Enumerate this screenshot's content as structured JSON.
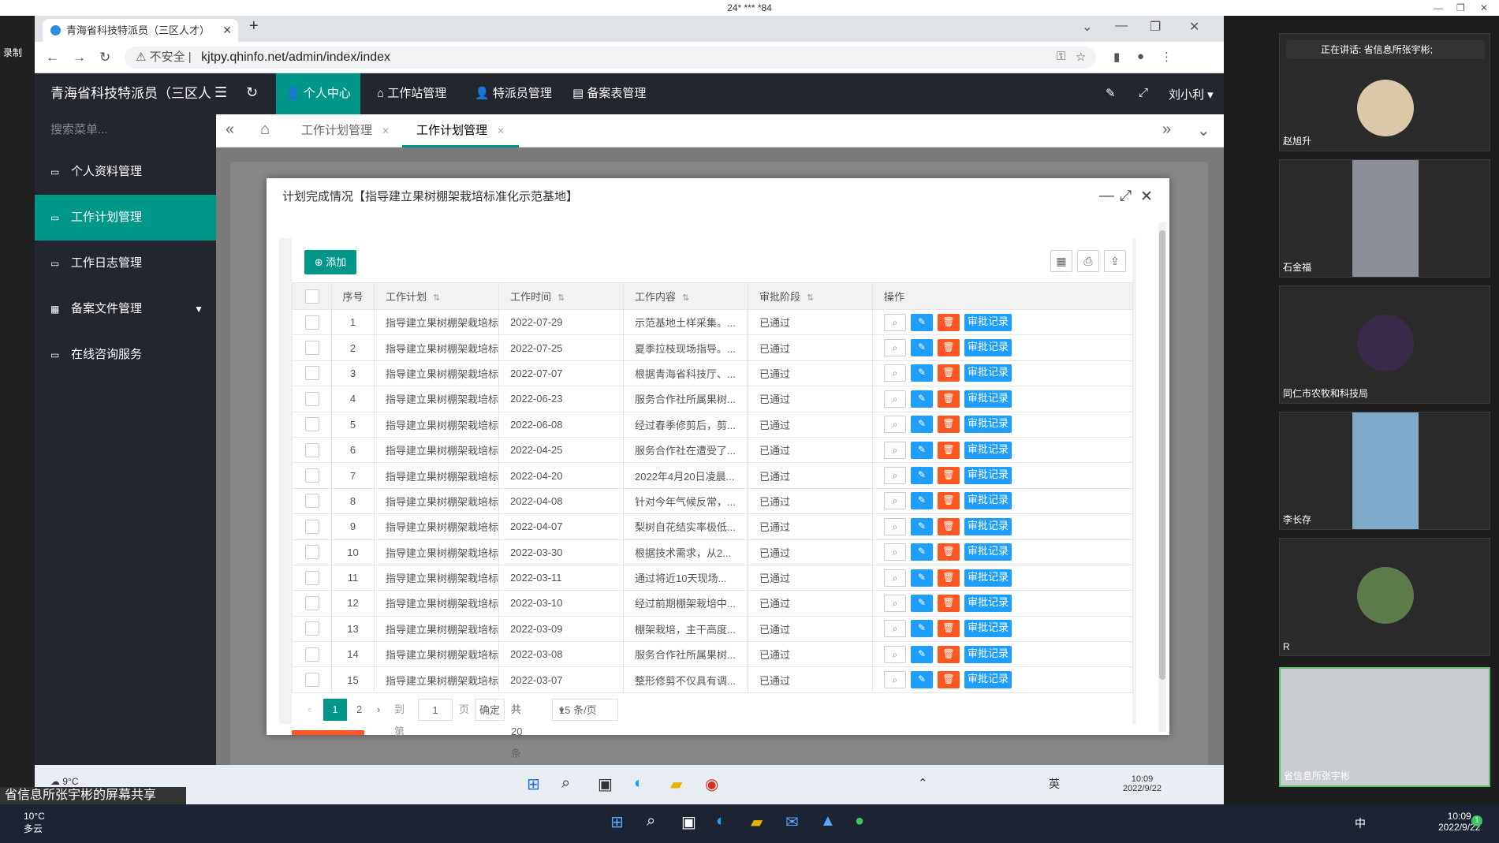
{
  "top_caption": "24* *** *84",
  "browser": {
    "tab_title": "青海省科技特派员（三区人才）",
    "url": "kjtpy.qhinfo.net/admin/index/index",
    "not_secure": "不安全"
  },
  "left_edge_label": "录制",
  "admin": {
    "brand": "青海省科技特派员（三区人",
    "top_nav": [
      "个人中心",
      "工作站管理",
      "特派员管理",
      "备案表管理"
    ],
    "user": "刘小利",
    "search_placeholder": "搜索菜单...",
    "sidebar": [
      "个人资料管理",
      "工作计划管理",
      "工作日志管理",
      "备案文件管理",
      "在线咨询服务"
    ],
    "page_tabs": [
      "工作计划管理",
      "工作计划管理"
    ]
  },
  "dialog": {
    "title": "计划完成情况【指导建立果树棚架栽培标准化示范基地】",
    "add_label": "添加",
    "columns": [
      "序号",
      "工作计划",
      "工作时间",
      "工作内容",
      "审批阶段",
      "操作"
    ],
    "record_btn": "审批记录",
    "rows": [
      {
        "no": "1",
        "plan": "指导建立果树棚架栽培标",
        "date": "2022-07-29",
        "content": "示范基地土样采集。...",
        "stage": "已通过"
      },
      {
        "no": "2",
        "plan": "指导建立果树棚架栽培标",
        "date": "2022-07-25",
        "content": "夏季拉枝现场指导。...",
        "stage": "已通过"
      },
      {
        "no": "3",
        "plan": "指导建立果树棚架栽培标",
        "date": "2022-07-07",
        "content": "根据青海省科技厅、...",
        "stage": "已通过"
      },
      {
        "no": "4",
        "plan": "指导建立果树棚架栽培标",
        "date": "2022-06-23",
        "content": "服务合作社所属果树...",
        "stage": "已通过"
      },
      {
        "no": "5",
        "plan": "指导建立果树棚架栽培标",
        "date": "2022-06-08",
        "content": "经过春季修剪后，剪...",
        "stage": "已通过"
      },
      {
        "no": "6",
        "plan": "指导建立果树棚架栽培标",
        "date": "2022-04-25",
        "content": "服务合作社在遭受了...",
        "stage": "已通过"
      },
      {
        "no": "7",
        "plan": "指导建立果树棚架栽培标",
        "date": "2022-04-20",
        "content": "2022年4月20日凌晨...",
        "stage": "已通过"
      },
      {
        "no": "8",
        "plan": "指导建立果树棚架栽培标",
        "date": "2022-04-08",
        "content": "针对今年气候反常，...",
        "stage": "已通过"
      },
      {
        "no": "9",
        "plan": "指导建立果树棚架栽培标",
        "date": "2022-04-07",
        "content": "梨树自花结实率极低...",
        "stage": "已通过"
      },
      {
        "no": "10",
        "plan": "指导建立果树棚架栽培标",
        "date": "2022-03-30",
        "content": "根据技术需求，从2...",
        "stage": "已通过"
      },
      {
        "no": "11",
        "plan": "指导建立果树棚架栽培标",
        "date": "2022-03-11",
        "content": "通过将近10天现场...",
        "stage": "已通过"
      },
      {
        "no": "12",
        "plan": "指导建立果树棚架栽培标",
        "date": "2022-03-10",
        "content": "经过前期棚架栽培中...",
        "stage": "已通过"
      },
      {
        "no": "13",
        "plan": "指导建立果树棚架栽培标",
        "date": "2022-03-09",
        "content": "棚架栽培，主干高度...",
        "stage": "已通过"
      },
      {
        "no": "14",
        "plan": "指导建立果树棚架栽培标",
        "date": "2022-03-08",
        "content": "服务合作社所属果树...",
        "stage": "已通过"
      },
      {
        "no": "15",
        "plan": "指导建立果树棚架栽培标",
        "date": "2022-03-07",
        "content": "整形修剪不仅具有调...",
        "stage": "已通过"
      }
    ],
    "pager": {
      "page1": "1",
      "page2": "2",
      "goto": "到第",
      "goto_value": "1",
      "page_unit": "页",
      "confirm": "确定",
      "total": "共 20 条",
      "per_page": "15 条/页"
    }
  },
  "taskbar_inner": {
    "weather": "9°C",
    "ime": "英",
    "time": "10:09",
    "date": "2022/9/22"
  },
  "share_label": "省信息所张宇彬的屏幕共享",
  "windows_taskbar": {
    "temp": "10°C",
    "weather_text": "多云",
    "ime": "中",
    "time": "10:09",
    "date": "2022/9/22",
    "badge": "1"
  },
  "meeting": {
    "speaking": "正在讲话: 省信息所张宇彬;",
    "participants": [
      "赵旭升",
      "石金福",
      "同仁市农牧和科技局",
      "李长存",
      "R",
      "省信息所张宇彬"
    ]
  },
  "colors": {
    "accent": "#009688",
    "link": "#1e9fff",
    "danger": "#ff5722",
    "approved": "#5fb878",
    "header": "#23262e"
  }
}
